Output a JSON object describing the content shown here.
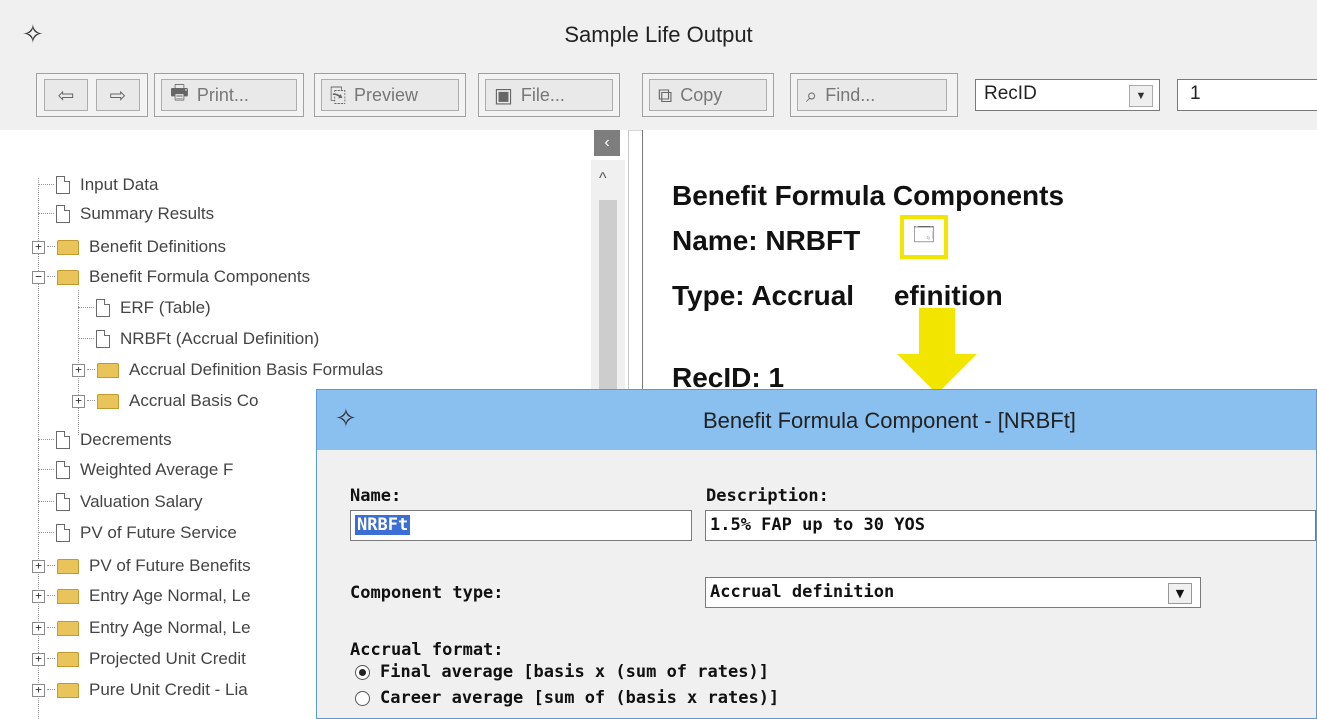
{
  "window": {
    "title": "Sample Life Output"
  },
  "toolbar": {
    "print_label": "Print...",
    "preview_label": "Preview",
    "file_label": "File...",
    "copy_label": "Copy",
    "find_label": "Find...",
    "recid_value": "RecID",
    "record_number": "1"
  },
  "tree": {
    "items": [
      {
        "label": "Input Data"
      },
      {
        "label": "Summary Results"
      },
      {
        "label": "Benefit Definitions"
      },
      {
        "label": "Benefit Formula Components"
      },
      {
        "label": "ERF (Table)"
      },
      {
        "label": "NRBFt (Accrual Definition)"
      },
      {
        "label": "Accrual Definition Basis Formulas"
      },
      {
        "label": "Accrual Basis Co"
      },
      {
        "label": "Decrements"
      },
      {
        "label": "Weighted Average F"
      },
      {
        "label": "Valuation Salary"
      },
      {
        "label": "PV of Future Service"
      },
      {
        "label": "PV of Future Benefits"
      },
      {
        "label": "Entry Age Normal, Le"
      },
      {
        "label": "Entry Age Normal, Le"
      },
      {
        "label": "Projected Unit Credit"
      },
      {
        "label": "Pure Unit Credit - Lia"
      }
    ]
  },
  "content": {
    "heading1": "Benefit Formula Components",
    "heading2": "Name: NRBFT",
    "heading3_a": "Type: Accrual ",
    "heading3_b": "efinition",
    "heading4": "RecID: 1"
  },
  "dialog": {
    "title": "Benefit Formula Component - [NRBFt]",
    "name_label": "Name:",
    "name_value": "NRBFt",
    "description_label": "Description:",
    "description_value": "1.5% FAP up to 30 YOS",
    "component_type_label": "Component type:",
    "component_type_value": "Accrual definition",
    "accrual_format_label": "Accrual format:",
    "option_final": "Final average [basis x (sum of rates)]",
    "option_career": "Career average [sum of (basis x rates)]"
  },
  "colors": {
    "highlight_yellow": "#f2e600",
    "dialog_titlebar": "#89c0f0",
    "selection_blue": "#3b6fd5"
  }
}
